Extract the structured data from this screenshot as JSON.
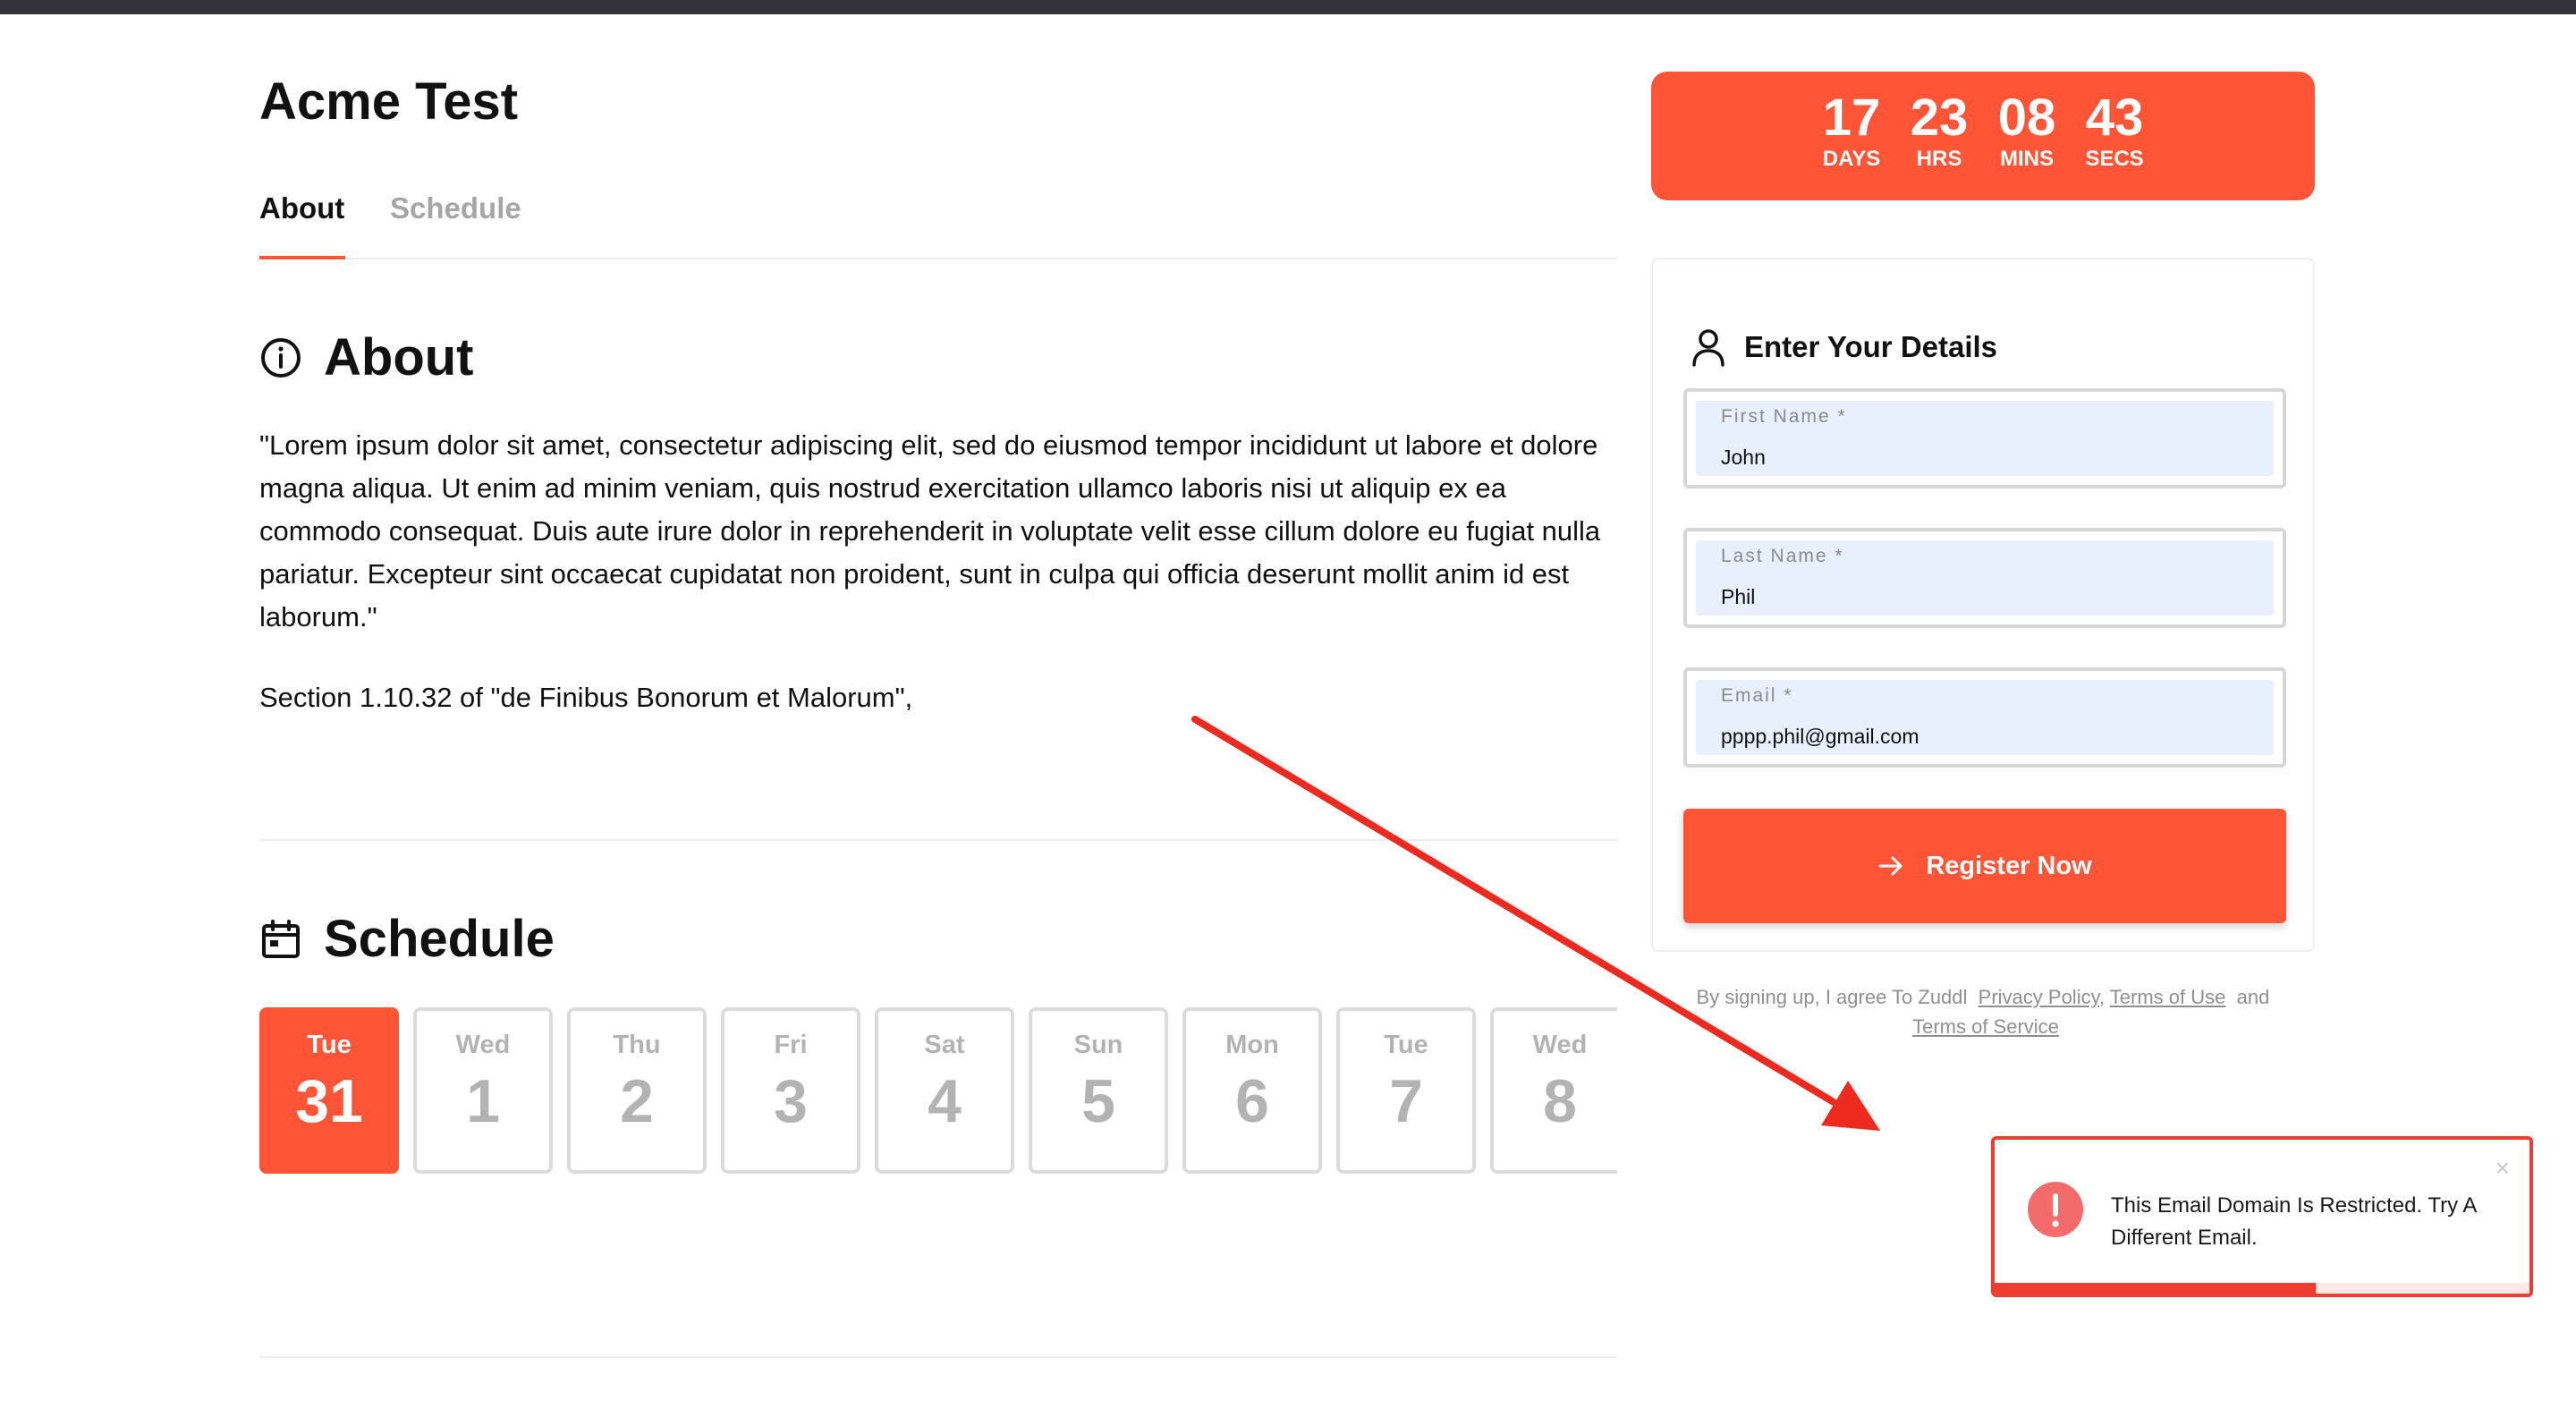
{
  "event": {
    "title": "Acme Test"
  },
  "tabs": [
    {
      "label": "About",
      "active": true
    },
    {
      "label": "Schedule",
      "active": false
    }
  ],
  "about": {
    "heading": "About",
    "icon": "info-icon",
    "body": "\"Lorem ipsum dolor sit amet, consectetur adipiscing elit, sed do eiusmod tempor incididunt ut labore et dolore magna aliqua. Ut enim ad minim veniam, quis nostrud exercitation ullamco laboris nisi ut aliquip ex ea commodo consequat. Duis aute irure dolor in reprehenderit in voluptate velit esse cillum dolore eu fugiat nulla pariatur. Excepteur sint occaecat cupidatat non proident, sunt in culpa qui officia deserunt mollit anim id est laborum.\"",
    "reference": "Section 1.10.32 of \"de Finibus Bonorum et Malorum\","
  },
  "schedule": {
    "heading": "Schedule",
    "icon": "calendar-icon",
    "days": [
      {
        "name": "Tue",
        "num": "31",
        "selected": true
      },
      {
        "name": "Wed",
        "num": "1",
        "selected": false
      },
      {
        "name": "Thu",
        "num": "2",
        "selected": false
      },
      {
        "name": "Fri",
        "num": "3",
        "selected": false
      },
      {
        "name": "Sat",
        "num": "4",
        "selected": false
      },
      {
        "name": "Sun",
        "num": "5",
        "selected": false
      },
      {
        "name": "Mon",
        "num": "6",
        "selected": false
      },
      {
        "name": "Tue",
        "num": "7",
        "selected": false
      },
      {
        "name": "Wed",
        "num": "8",
        "selected": false
      }
    ]
  },
  "countdown": {
    "days": "17",
    "days_label": "DAYS",
    "hrs": "23",
    "hrs_label": "HRS",
    "mins": "08",
    "mins_label": "MINS",
    "secs": "43",
    "secs_label": "SECS"
  },
  "form": {
    "title": "Enter Your Details",
    "icon": "user-icon",
    "first_name": {
      "label": "First Name *",
      "value": "John"
    },
    "last_name": {
      "label": "Last Name *",
      "value": "Phil"
    },
    "email": {
      "label": "Email *",
      "value": "pppp.phil@gmail.com"
    },
    "submit_label": "Register Now",
    "submit_icon": "arrow-right-icon"
  },
  "terms": {
    "prefix": "By signing up, I agree To Zuddl",
    "privacy": "Privacy Policy",
    "comma": ",",
    "terms_of_use": "Terms of Use",
    "and": "and",
    "terms_of_service": "Terms of Service"
  },
  "toast": {
    "message": "This Email Domain Is Restricted. Try A Different Email.",
    "icon": "error-icon",
    "close": "×",
    "progress": 0.6
  },
  "colors": {
    "accent": "#ff5436",
    "error": "#f03c2e",
    "autofill": "#e8f0fe",
    "annotation": "#ee2a1f"
  }
}
